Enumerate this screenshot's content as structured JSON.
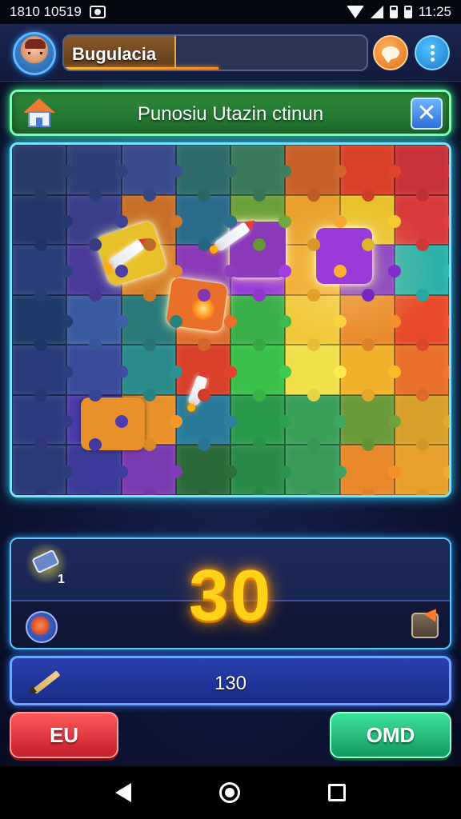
{
  "status_bar": {
    "left_text": "1810 10519",
    "time": "11:25"
  },
  "header": {
    "player_name": "Bugulacia",
    "progress": 0.37
  },
  "banner": {
    "title": "Punosiu Utazin ctinun",
    "close_label": "✕"
  },
  "board": {
    "rows": 7,
    "cols": 8,
    "colors": [
      [
        "#2a3a6a",
        "#2e3f78",
        "#3a4a8a",
        "#2f6a6a",
        "#3a7a5a",
        "#c8602a",
        "#d8402a",
        "#c8323a"
      ],
      [
        "#24356a",
        "#3a3f8a",
        "#c8702a",
        "#2a6a8a",
        "#6aa03a",
        "#e8a02a",
        "#e8c02a",
        "#d83a3a"
      ],
      [
        "#2a3f7a",
        "#4a3a9a",
        "#d8802a",
        "#8a3ab8",
        "#9a3ad8",
        "#f0a82a",
        "#7a2ac8",
        "#2ab0a8"
      ],
      [
        "#1f3a6a",
        "#3a5aa0",
        "#2a7a7a",
        "#e06a2a",
        "#3ab04a",
        "#f0c83a",
        "#e8882a",
        "#e84a2a"
      ],
      [
        "#2a3a7a",
        "#3a4a9a",
        "#2a8a8a",
        "#d8402a",
        "#3ac04a",
        "#f0e04a",
        "#f0b02a",
        "#e8702a"
      ],
      [
        "#2f3a80",
        "#4a3aa8",
        "#e8902a",
        "#2a7a9a",
        "#2a9a4a",
        "#3aa05a",
        "#6a9a3a",
        "#d8a02a"
      ],
      [
        "#2a3a78",
        "#3a3a98",
        "#7a3ab0",
        "#2a6a3a",
        "#2a8a4a",
        "#3a9a5a",
        "#e8882a",
        "#e8a02a"
      ]
    ]
  },
  "score": {
    "badge_count": "1",
    "main_value": "30"
  },
  "count_bar": {
    "value": "130"
  },
  "buttons": {
    "left_label": "EU",
    "right_label": "OMD"
  },
  "icons": {
    "header_chat": "chat-bubble-icon",
    "header_more": "more-vertical-icon",
    "banner": "house-icon",
    "score_badge": "ticket-icon",
    "score_left": "compass-icon",
    "score_right": "export-icon",
    "count": "pencil-icon"
  },
  "theme": {
    "accent_gold": "#ffd21a",
    "frame_cyan": "#6ee8ff",
    "banner_green": "#2f8a3a",
    "button_red": "#c51c2a",
    "button_green": "#129a5e"
  }
}
